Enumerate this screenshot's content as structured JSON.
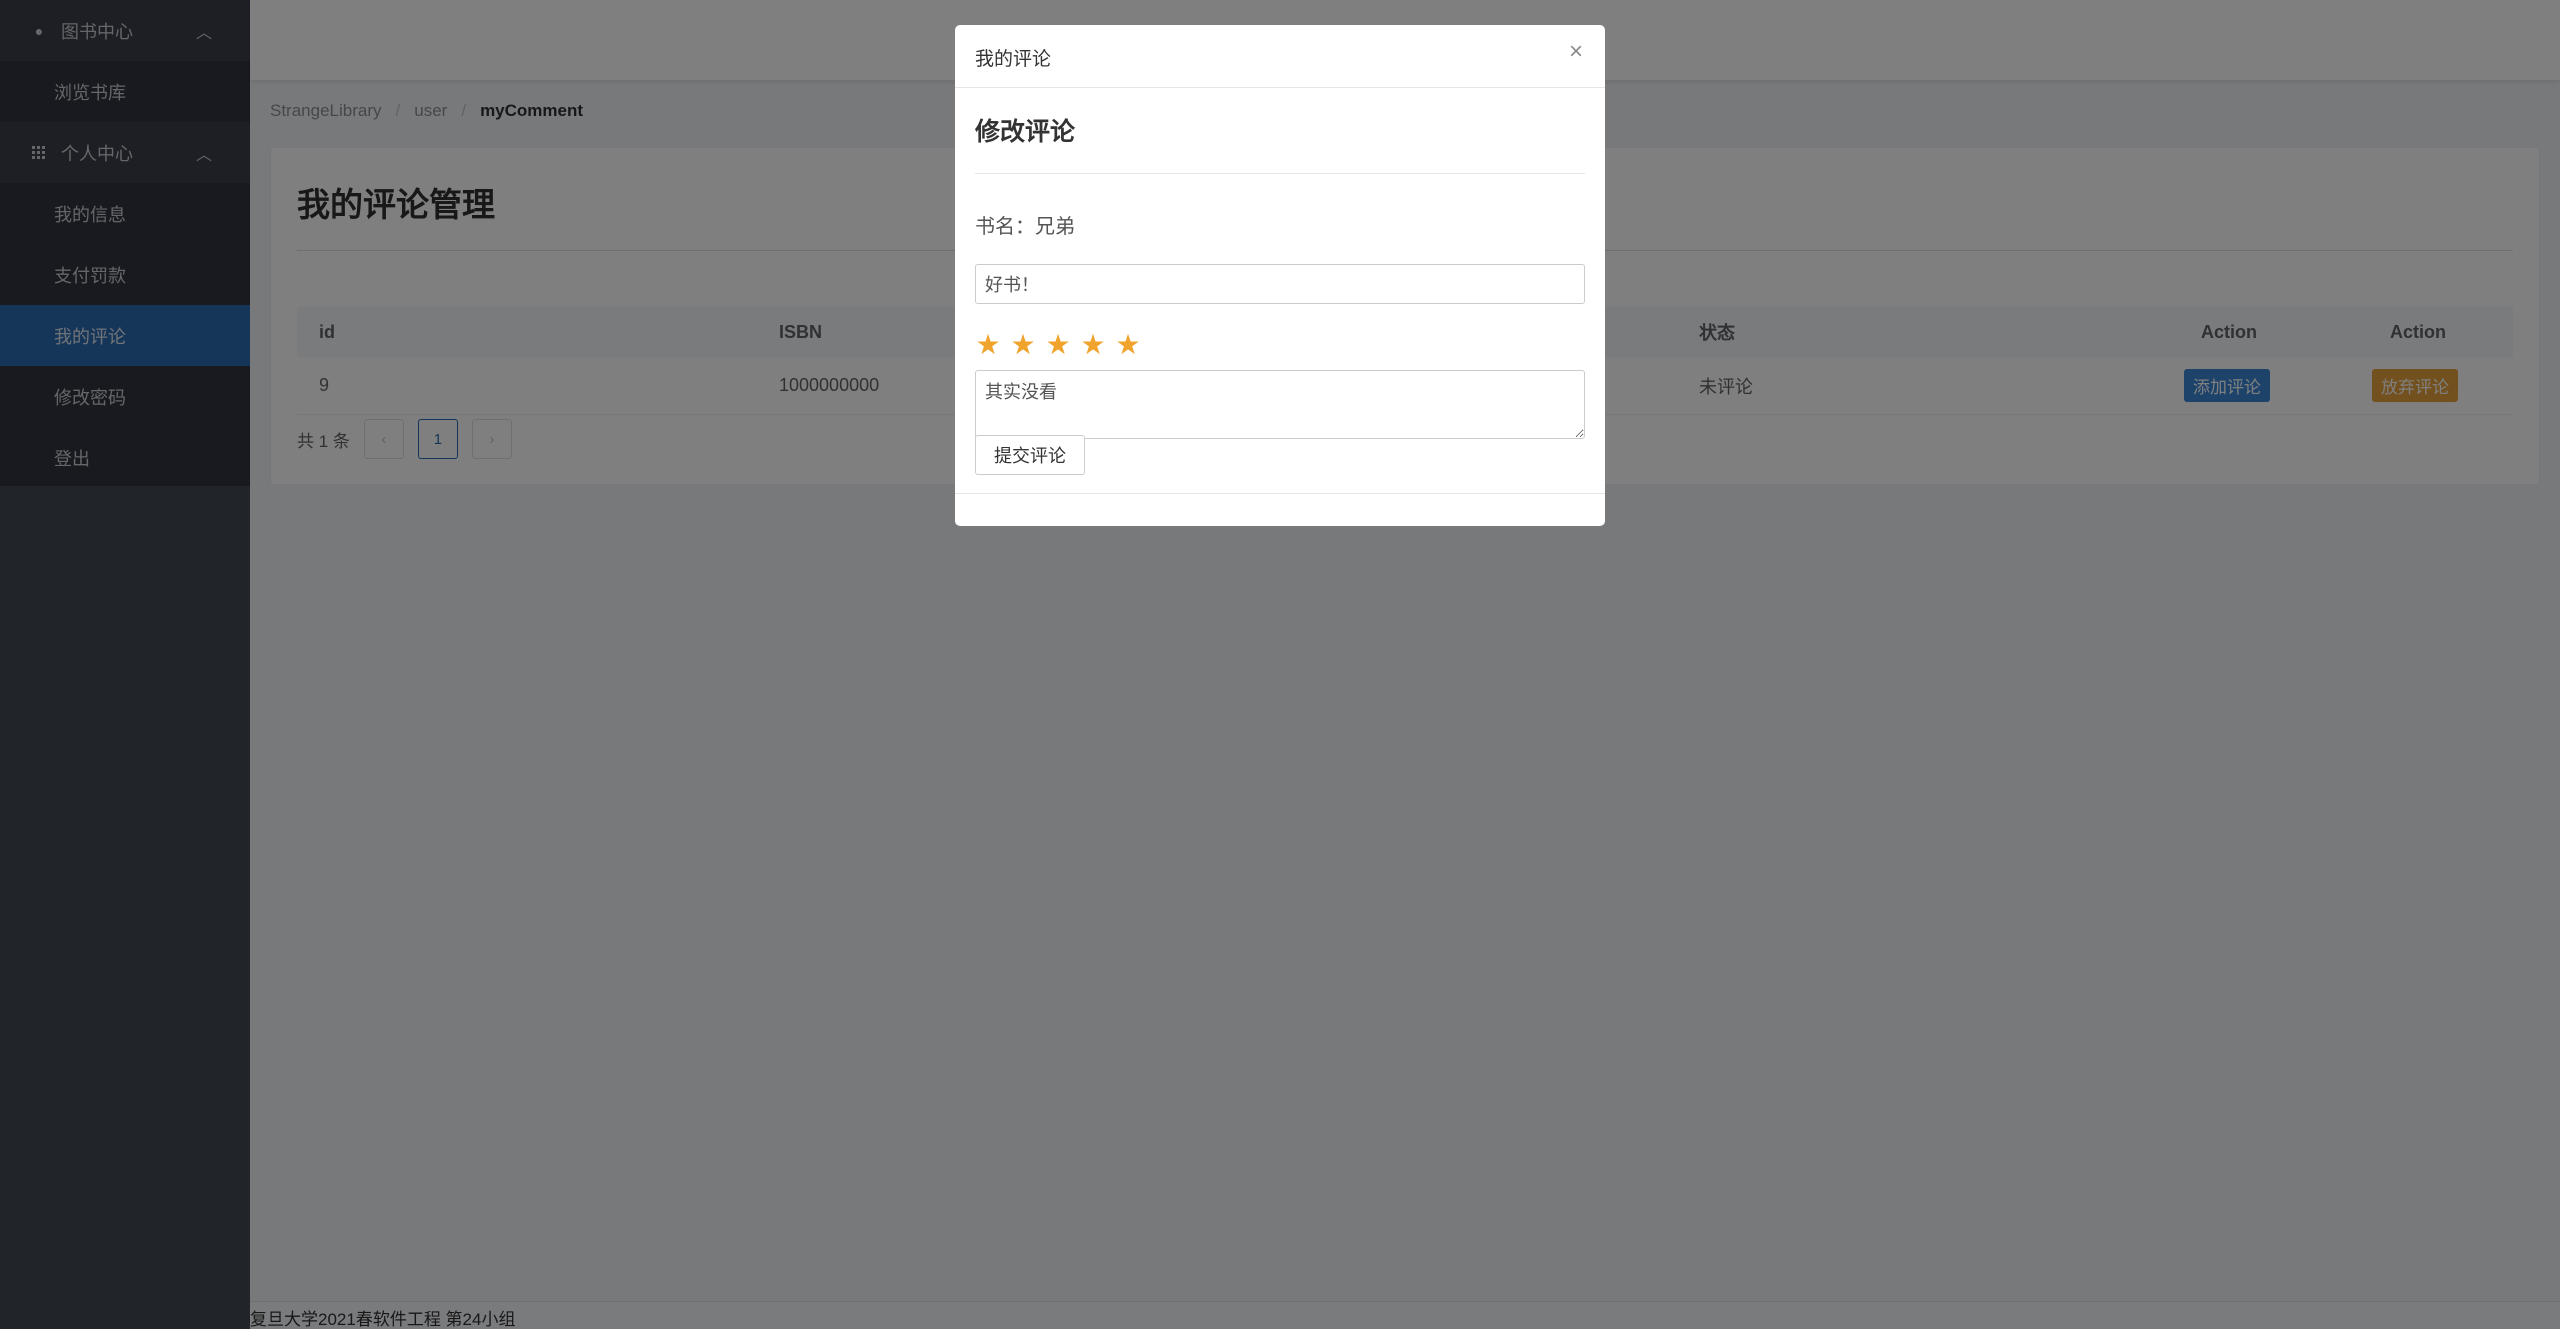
{
  "sidebar": {
    "groups": [
      {
        "label": "图书中心",
        "icon": "circle-icon",
        "items": [
          {
            "label": "浏览书库"
          }
        ]
      },
      {
        "label": "个人中心",
        "icon": "grid-icon",
        "items": [
          {
            "label": "我的信息"
          },
          {
            "label": "支付罚款"
          },
          {
            "label": "我的评论",
            "active": true
          },
          {
            "label": "修改密码"
          },
          {
            "label": "登出"
          }
        ]
      }
    ]
  },
  "breadcrumb": [
    "StrangeLibrary",
    "user",
    "myComment"
  ],
  "page": {
    "title": "我的评论管理"
  },
  "table": {
    "columns": [
      "id",
      "ISBN",
      "状态",
      "Action",
      "Action"
    ],
    "rows": [
      {
        "id": "9",
        "isbn": "1000000000",
        "status": "未评论",
        "add_label": "添加评论",
        "abandon_label": "放弃评论"
      }
    ]
  },
  "pagination": {
    "total_label": "共 1 条",
    "current_page": "1",
    "prev": "‹",
    "next": "›"
  },
  "footer": {
    "text": "复旦大学2021春软件工程 第24小组"
  },
  "modal": {
    "title": "我的评论",
    "close": "×",
    "edit_title": "修改评论",
    "book_label": "书名：",
    "book_name": "兄弟",
    "title_value": "好书！",
    "rating": 5,
    "star_glyph": "★",
    "content_value": "其实没看",
    "submit_label": "提交评论"
  },
  "colors": {
    "accent": "#2a6cb0",
    "primary_button": "#3a87d6",
    "warning_button": "#e6a23c",
    "star": "#f0a42e",
    "sidebar": "#393e4a"
  }
}
